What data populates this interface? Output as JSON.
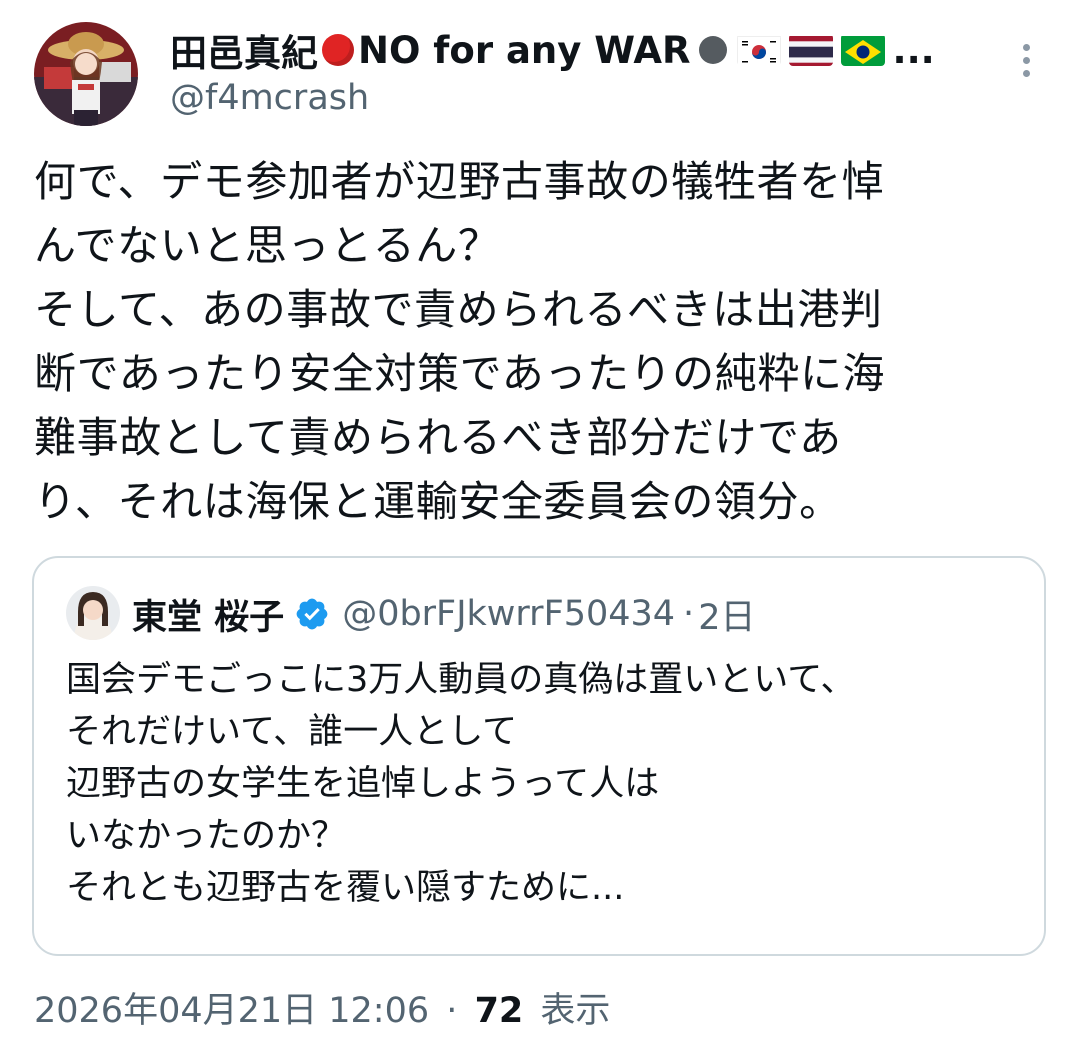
{
  "author": {
    "name": "田邑真紀",
    "slogan": "NO for any WAR",
    "ellipsis": "...",
    "handle": "@f4mcrash",
    "flags": [
      "kr-flag-icon",
      "th-flag-icon",
      "br-flag-icon"
    ]
  },
  "tweet": {
    "text": "何で、デモ参加者が辺野古事故の犠牲者を悼\nんでないと思っとるん？\nそして、あの事故で責められるべきは出港判\n断であったり安全対策であったりの純粋に海\n難事故として責められるべき部分だけであ\nり、それは海保と運輸安全委員会の領分。"
  },
  "quote": {
    "name": "東堂 桜子",
    "handle": "@0brFJkwrrF50434",
    "separator": "·",
    "time": "2日",
    "text": "国会デモごっこに3万人動員の真偽は置いといて、\nそれだけいて、誰一人として\n辺野古の女学生を追悼しようって人は\nいなかったのか？\nそれとも辺野古を覆い隠すために..."
  },
  "meta": {
    "timestamp": "2026年04月21日 12:06",
    "separator": "·",
    "views_count": "72",
    "views_label": "表示"
  },
  "colors": {
    "text": "#0f1419",
    "secondary": "#536471",
    "border": "#cfd9de",
    "verified": "#1d9bf0"
  }
}
